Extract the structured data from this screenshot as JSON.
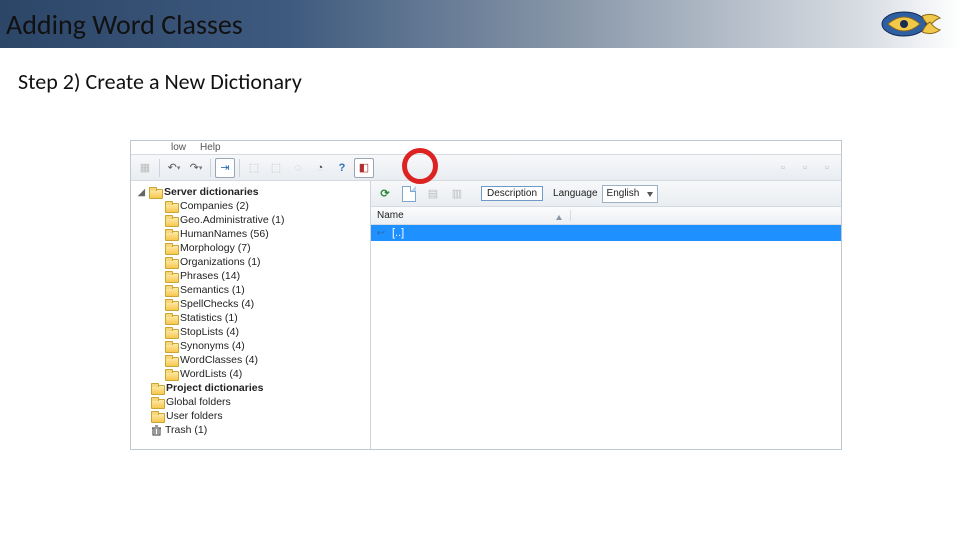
{
  "header": {
    "title": "Adding Word Classes"
  },
  "step": {
    "text": "Step 2) Create a New Dictionary"
  },
  "menu_fragment": [
    "low",
    "Help"
  ],
  "toolbar_main": {
    "undo_glyph": "↶",
    "redo_glyph": "↷",
    "help_glyph": "?",
    "clock_glyph": "◔",
    "bookmark_glyph": "◧"
  },
  "tree": {
    "root_label": "Server dictionaries",
    "children": [
      {
        "label": "Companies (2)"
      },
      {
        "label": "Geo.Administrative (1)"
      },
      {
        "label": "HumanNames (56)"
      },
      {
        "label": "Morphology (7)"
      },
      {
        "label": "Organizations (1)"
      },
      {
        "label": "Phrases (14)"
      },
      {
        "label": "Semantics (1)"
      },
      {
        "label": "SpellChecks (4)"
      },
      {
        "label": "Statistics (1)"
      },
      {
        "label": "StopLists (4)"
      },
      {
        "label": "Synonyms (4)"
      },
      {
        "label": "WordClasses (4)"
      },
      {
        "label": "WordLists (4)"
      }
    ],
    "siblings": [
      {
        "label": "Project dictionaries",
        "bold": true
      },
      {
        "label": "Global folders"
      },
      {
        "label": "User folders"
      },
      {
        "label": "Trash (1)",
        "icon": "trash"
      }
    ]
  },
  "right_toolbar": {
    "description_label": "Description",
    "language_label": "Language",
    "language_value": "English"
  },
  "columns": {
    "name": "Name"
  },
  "list": {
    "updir_label": "[..]"
  }
}
